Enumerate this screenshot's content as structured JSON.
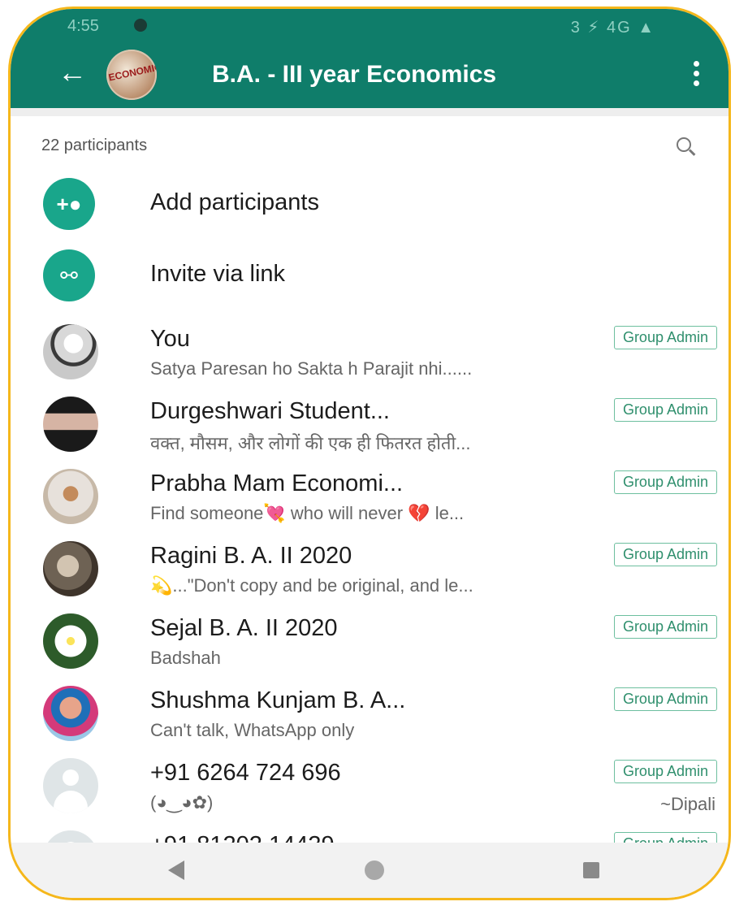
{
  "status_bar": {
    "time": "4:55",
    "right": "3 ⚡ 4G ▲"
  },
  "header": {
    "back_icon": "arrow-left-icon",
    "group_avatar_text": "ECONOMICS",
    "title": "B.A. - III year Economics",
    "menu_icon": "more-vertical-icon"
  },
  "participants_count": "22 participants",
  "actions": [
    {
      "label": "Add participants",
      "icon": "add-person-icon"
    },
    {
      "label": "Invite via link",
      "icon": "link-icon"
    }
  ],
  "badge_label": "Group Admin",
  "members": [
    {
      "name": "You",
      "status": "Satya Paresan ho Sakta h Parajit nhi......"
    },
    {
      "name": "Durgeshwari Student...",
      "status": "वक्त,  मौसम, और लोगों की एक ही फितरत होती..."
    },
    {
      "name": "Prabha Mam Economi...",
      "status": "Find someone💘 who will never 💔 le..."
    },
    {
      "name": "Ragini B. A. II 2020",
      "status": "💫...\"Don't copy and be original, and le..."
    },
    {
      "name": "Sejal B. A. II 2020",
      "status": "Badshah"
    },
    {
      "name": "Shushma Kunjam B. A...",
      "status": "Can't talk, WhatsApp only"
    },
    {
      "name": "+91 6264 724 696",
      "status": "(◕‿◕✿)",
      "sub": "~Dipali"
    },
    {
      "name": "+91 81202 14439",
      "status": "😊😊✨🌿🌹🌿✨😊 ... 😊"
    }
  ],
  "nav": {
    "back": "nav-back-icon",
    "home": "nav-home-icon",
    "recents": "nav-recents-icon"
  }
}
